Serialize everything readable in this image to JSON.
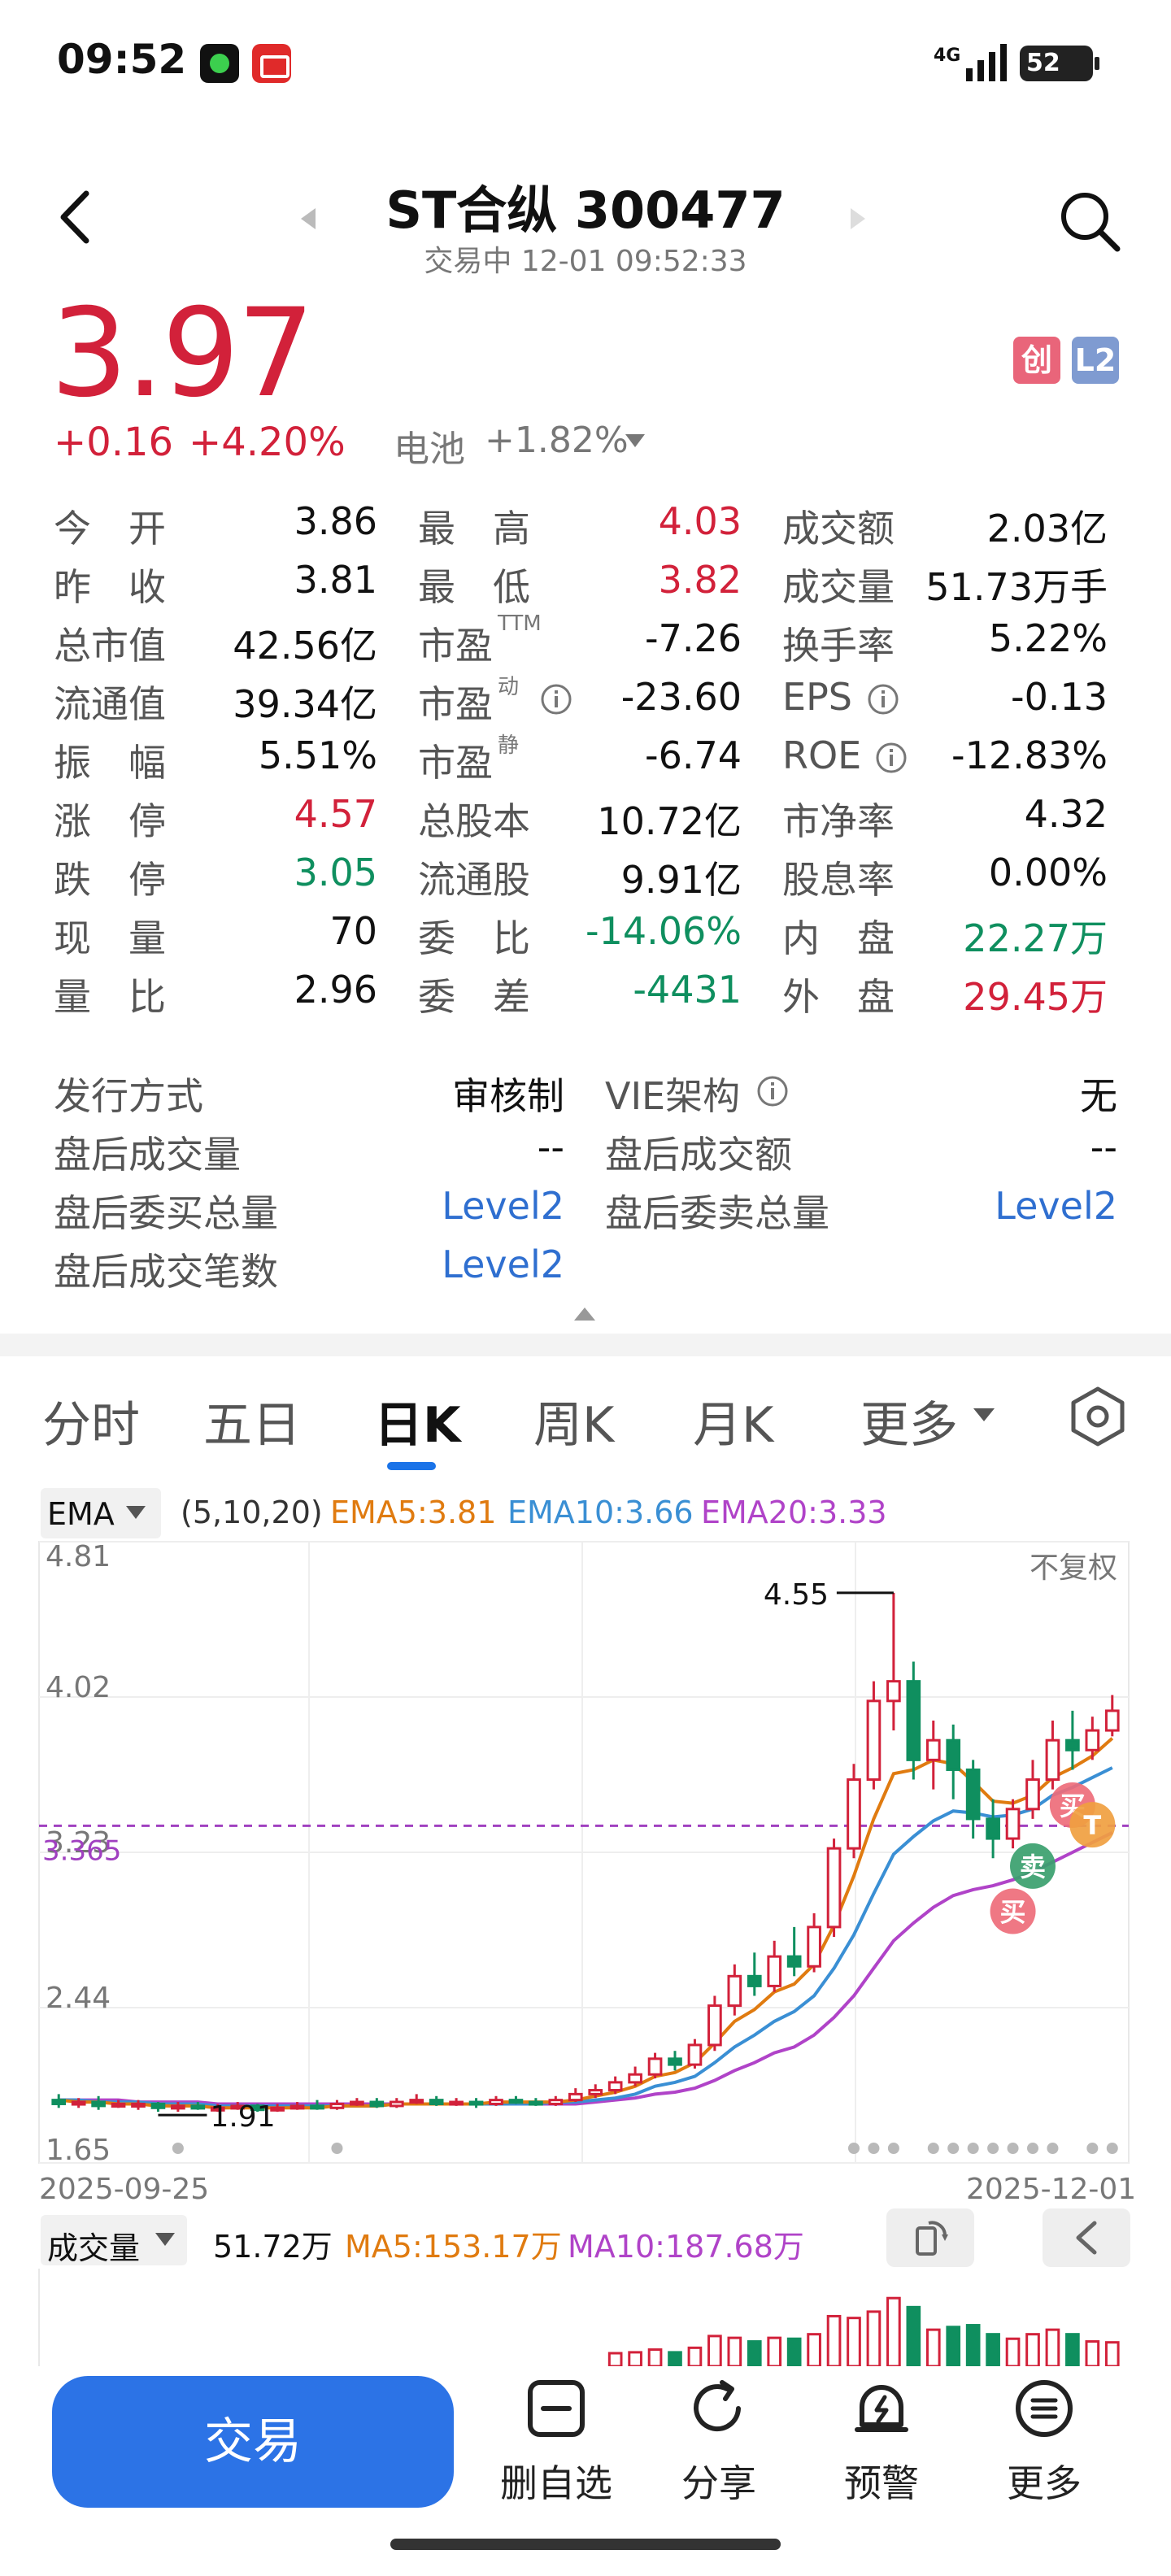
{
  "status_bar": {
    "time": "09:52",
    "network": "4G",
    "battery": "52"
  },
  "header": {
    "title": "ST合纵 300477",
    "subtitle": "交易中  12-01 09:52:33"
  },
  "quote": {
    "price": "3.97",
    "change": "+0.16",
    "change_pct": "+4.20%",
    "sector_name": "电池",
    "sector_pct": "+1.82%",
    "tags": [
      "创",
      "L2"
    ]
  },
  "stats": {
    "col1": [
      {
        "label": "今　开",
        "value": "3.86"
      },
      {
        "label": "昨　收",
        "value": "3.81"
      },
      {
        "label": "总市值",
        "value": "42.56亿"
      },
      {
        "label": "流通值",
        "value": "39.34亿"
      },
      {
        "label": "振　幅",
        "value": "5.51%"
      },
      {
        "label": "涨　停",
        "value": "4.57"
      },
      {
        "label": "跌　停",
        "value": "3.05"
      },
      {
        "label": "现　量",
        "value": "70"
      },
      {
        "label": "量　比",
        "value": "2.96"
      }
    ],
    "col2": [
      {
        "label": "最　高",
        "value": "4.03"
      },
      {
        "label": "最　低",
        "value": "3.82"
      },
      {
        "label": "市盈",
        "sup": "TTM",
        "value": "-7.26"
      },
      {
        "label": "市盈",
        "sup": "动",
        "value": "-23.60"
      },
      {
        "label": "市盈",
        "sup": "静",
        "value": "-6.74"
      },
      {
        "label": "总股本",
        "value": "10.72亿"
      },
      {
        "label": "流通股",
        "value": "9.91亿"
      },
      {
        "label": "委　比",
        "value": "-14.06%"
      },
      {
        "label": "委　差",
        "value": "-4431"
      }
    ],
    "col3": [
      {
        "label": "成交额",
        "value": "2.03亿"
      },
      {
        "label": "成交量",
        "value": "51.73万手"
      },
      {
        "label": "换手率",
        "value": "5.22%"
      },
      {
        "label": "EPS",
        "value": "-0.13"
      },
      {
        "label": "ROE",
        "value": "-12.83%"
      },
      {
        "label": "市净率",
        "value": "4.32"
      },
      {
        "label": "股息率",
        "value": "0.00%"
      },
      {
        "label": "内　盘",
        "value": "22.27万"
      },
      {
        "label": "外　盘",
        "value": "29.45万"
      }
    ]
  },
  "issuance": {
    "method_label": "发行方式",
    "method_value": "审核制",
    "vie_label": "VIE架构",
    "vie_value": "无",
    "ah_volume_label": "盘后成交量",
    "ah_volume_value": "--",
    "ah_amount_label": "盘后成交额",
    "ah_amount_value": "--",
    "ah_buy_label": "盘后委买总量",
    "ah_buy_value": "Level2",
    "ah_sell_label": "盘后委卖总量",
    "ah_sell_value": "Level2",
    "ah_trades_label": "盘后成交笔数",
    "ah_trades_value": "Level2"
  },
  "tabs": [
    "分时",
    "五日",
    "日K",
    "周K",
    "月K",
    "更多"
  ],
  "indicator": {
    "name": "EMA",
    "params": "(5,10,20)",
    "ema5": "EMA5:3.81",
    "ema10": "EMA10:3.66",
    "ema20": "EMA20:3.33"
  },
  "volume_indicator": {
    "name": "成交量",
    "value": "51.72万",
    "ma5": "MA5:153.17万",
    "ma10": "MA10:187.68万"
  },
  "colors": {
    "up": "#d2213a",
    "down": "#0f8f5f",
    "ema5": "#e07b10",
    "ema10": "#3a8fd4",
    "ema20": "#b043c8",
    "accent": "#2c73e6"
  },
  "chart_data": {
    "type": "candlestick",
    "y_ticks": [
      "4.81",
      "4.02",
      "3.23",
      "2.44",
      "1.65"
    ],
    "ylim": [
      1.65,
      4.81
    ],
    "current_line": 3.365,
    "current_line_label": "3.365",
    "adjust_label": "不复权",
    "high_label": "4.55",
    "low_label": "1.91",
    "x_start": "2025-09-25",
    "x_end": "2025-12-01",
    "markers": [
      "买",
      "T",
      "卖",
      "买"
    ],
    "candles": [
      [
        1.97,
        1.95,
        2.0,
        1.93
      ],
      [
        1.95,
        1.96,
        1.98,
        1.93
      ],
      [
        1.96,
        1.94,
        1.99,
        1.92
      ],
      [
        1.95,
        1.95,
        1.97,
        1.93
      ],
      [
        1.94,
        1.95,
        1.97,
        1.92
      ],
      [
        1.95,
        1.93,
        1.96,
        1.91
      ],
      [
        1.93,
        1.94,
        1.96,
        1.91
      ],
      [
        1.94,
        1.93,
        1.96,
        1.92
      ],
      [
        1.92,
        1.93,
        1.95,
        1.91
      ],
      [
        1.93,
        1.94,
        1.96,
        1.92
      ],
      [
        1.94,
        1.92,
        1.95,
        1.91
      ],
      [
        1.92,
        1.93,
        1.95,
        1.91
      ],
      [
        1.93,
        1.94,
        1.96,
        1.92
      ],
      [
        1.94,
        1.93,
        1.97,
        1.92
      ],
      [
        1.93,
        1.95,
        1.97,
        1.92
      ],
      [
        1.95,
        1.96,
        1.98,
        1.94
      ],
      [
        1.96,
        1.94,
        1.98,
        1.93
      ],
      [
        1.94,
        1.96,
        1.98,
        1.93
      ],
      [
        1.96,
        1.97,
        2.0,
        1.95
      ],
      [
        1.97,
        1.95,
        1.99,
        1.94
      ],
      [
        1.95,
        1.96,
        1.98,
        1.94
      ],
      [
        1.96,
        1.95,
        1.98,
        1.93
      ],
      [
        1.95,
        1.97,
        1.99,
        1.94
      ],
      [
        1.97,
        1.96,
        1.99,
        1.95
      ],
      [
        1.96,
        1.95,
        1.98,
        1.94
      ],
      [
        1.95,
        1.97,
        1.99,
        1.94
      ],
      [
        1.97,
        2.0,
        2.03,
        1.96
      ],
      [
        2.0,
        2.02,
        2.05,
        1.98
      ],
      [
        2.02,
        2.06,
        2.09,
        2.0
      ],
      [
        2.06,
        2.1,
        2.14,
        2.04
      ],
      [
        2.1,
        2.18,
        2.21,
        2.08
      ],
      [
        2.18,
        2.15,
        2.22,
        2.12
      ],
      [
        2.15,
        2.25,
        2.28,
        2.13
      ],
      [
        2.25,
        2.45,
        2.5,
        2.22
      ],
      [
        2.45,
        2.6,
        2.66,
        2.4
      ],
      [
        2.6,
        2.55,
        2.72,
        2.5
      ],
      [
        2.55,
        2.7,
        2.78,
        2.52
      ],
      [
        2.7,
        2.65,
        2.85,
        2.6
      ],
      [
        2.65,
        2.85,
        2.92,
        2.62
      ],
      [
        2.85,
        3.25,
        3.3,
        2.8
      ],
      [
        3.25,
        3.6,
        3.68,
        3.2
      ],
      [
        3.6,
        4.0,
        4.1,
        3.55
      ],
      [
        4.0,
        4.1,
        4.55,
        3.85
      ],
      [
        4.1,
        3.7,
        4.2,
        3.6
      ],
      [
        3.7,
        3.8,
        3.9,
        3.55
      ],
      [
        3.8,
        3.65,
        3.88,
        3.5
      ],
      [
        3.65,
        3.4,
        3.7,
        3.3
      ],
      [
        3.4,
        3.3,
        3.5,
        3.2
      ],
      [
        3.3,
        3.45,
        3.5,
        3.25
      ],
      [
        3.45,
        3.6,
        3.7,
        3.4
      ],
      [
        3.6,
        3.8,
        3.9,
        3.55
      ],
      [
        3.8,
        3.75,
        3.95,
        3.65
      ],
      [
        3.75,
        3.85,
        3.92,
        3.7
      ],
      [
        3.85,
        3.95,
        4.03,
        3.82
      ]
    ],
    "ema5": [
      1.97,
      1.96,
      1.96,
      1.95,
      1.95,
      1.94,
      1.94,
      1.94,
      1.93,
      1.93,
      1.93,
      1.93,
      1.93,
      1.93,
      1.94,
      1.94,
      1.94,
      1.95,
      1.95,
      1.95,
      1.95,
      1.95,
      1.96,
      1.96,
      1.96,
      1.96,
      1.97,
      1.99,
      2.01,
      2.04,
      2.09,
      2.11,
      2.16,
      2.26,
      2.37,
      2.43,
      2.52,
      2.56,
      2.66,
      2.86,
      3.11,
      3.4,
      3.63,
      3.65,
      3.7,
      3.68,
      3.59,
      3.49,
      3.48,
      3.52,
      3.61,
      3.66,
      3.72,
      3.81
    ],
    "ema10": [
      1.97,
      1.97,
      1.96,
      1.96,
      1.96,
      1.95,
      1.95,
      1.95,
      1.94,
      1.94,
      1.94,
      1.94,
      1.94,
      1.94,
      1.94,
      1.94,
      1.94,
      1.95,
      1.95,
      1.95,
      1.95,
      1.95,
      1.95,
      1.95,
      1.95,
      1.96,
      1.96,
      1.97,
      1.98,
      2.0,
      2.04,
      2.06,
      2.09,
      2.16,
      2.24,
      2.3,
      2.37,
      2.42,
      2.5,
      2.64,
      2.81,
      3.02,
      3.22,
      3.31,
      3.39,
      3.44,
      3.43,
      3.41,
      3.42,
      3.45,
      3.52,
      3.56,
      3.61,
      3.66
    ],
    "ema20": [
      1.97,
      1.97,
      1.97,
      1.97,
      1.96,
      1.96,
      1.96,
      1.96,
      1.95,
      1.95,
      1.95,
      1.95,
      1.95,
      1.95,
      1.95,
      1.95,
      1.95,
      1.95,
      1.95,
      1.95,
      1.95,
      1.95,
      1.95,
      1.95,
      1.95,
      1.95,
      1.95,
      1.96,
      1.97,
      1.98,
      2.0,
      2.01,
      2.03,
      2.07,
      2.12,
      2.16,
      2.21,
      2.24,
      2.3,
      2.39,
      2.5,
      2.64,
      2.78,
      2.87,
      2.95,
      3.01,
      3.04,
      3.06,
      3.09,
      3.13,
      3.18,
      3.23,
      3.28,
      3.33
    ]
  }
}
